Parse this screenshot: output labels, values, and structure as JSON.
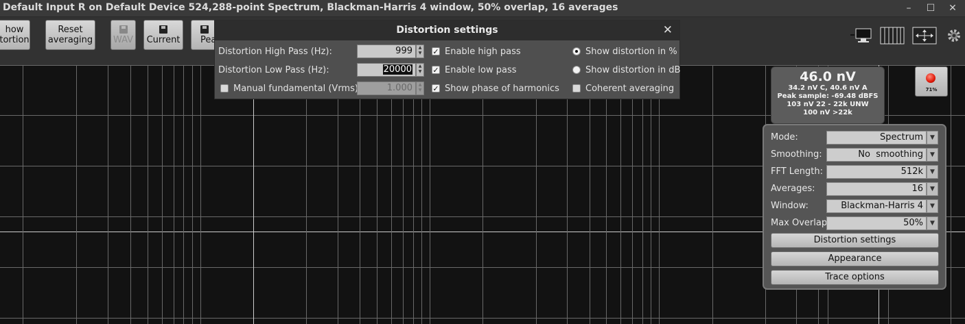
{
  "window": {
    "title": "Default Input R on Default Device 524,288-point Spectrum, Blackman-Harris 4 window, 50% overlap, 16 averages",
    "minimize": "–",
    "maximize": "☐",
    "close": "✕"
  },
  "toolbar": {
    "show_distortion_line1": "how",
    "show_distortion_line2": "tortion",
    "reset_line1": "Reset",
    "reset_line2": "averaging",
    "wav_label": "WAV",
    "current_label": "Current",
    "peak_label": "Pea"
  },
  "dialog": {
    "title": "Distortion settings",
    "close": "✕",
    "high_pass_label": "Distortion High Pass (Hz):",
    "high_pass_value": "999",
    "low_pass_label": "Distortion Low Pass (Hz):",
    "low_pass_value": "20000",
    "manual_fundamental_label": "Manual fundamental (Vrms)",
    "manual_fundamental_value": "1.000",
    "enable_high_pass_label": "Enable high pass",
    "enable_low_pass_label": "Enable low pass",
    "show_phase_label": "Show phase of harmonics",
    "show_pct_label": "Show distortion in %",
    "show_db_label": "Show distortion in dB",
    "coherent_label": "Coherent averaging",
    "check_mark": "✓"
  },
  "reading": {
    "main": "46.0 nV",
    "line1": "34.2 nV C, 40.6 nV A",
    "line2": "Peak sample: -69.48 dBFS",
    "line3": "103 nV 22 - 22k UNW",
    "line4": "100 nV >22k",
    "indicator_pct": "71%"
  },
  "settings": {
    "mode_label": "Mode:",
    "mode_value": "Spectrum",
    "smoothing_label": "Smoothing:",
    "smoothing_value": "No  smoothing",
    "fft_label": "FFT Length:",
    "fft_value": "512k",
    "averages_label": "Averages:",
    "averages_value": "16",
    "window_label": "Window:",
    "window_value": "Blackman-Harris 4",
    "overlap_label": "Max Overlap:",
    "overlap_value": "50%",
    "distortion_btn": "Distortion settings",
    "appearance_btn": "Appearance",
    "trace_btn": "Trace options",
    "drop_glyph": "▼"
  },
  "colors": {
    "background": "#121212",
    "grid": "#6a6a6a",
    "indicator": "#e01a0a"
  }
}
